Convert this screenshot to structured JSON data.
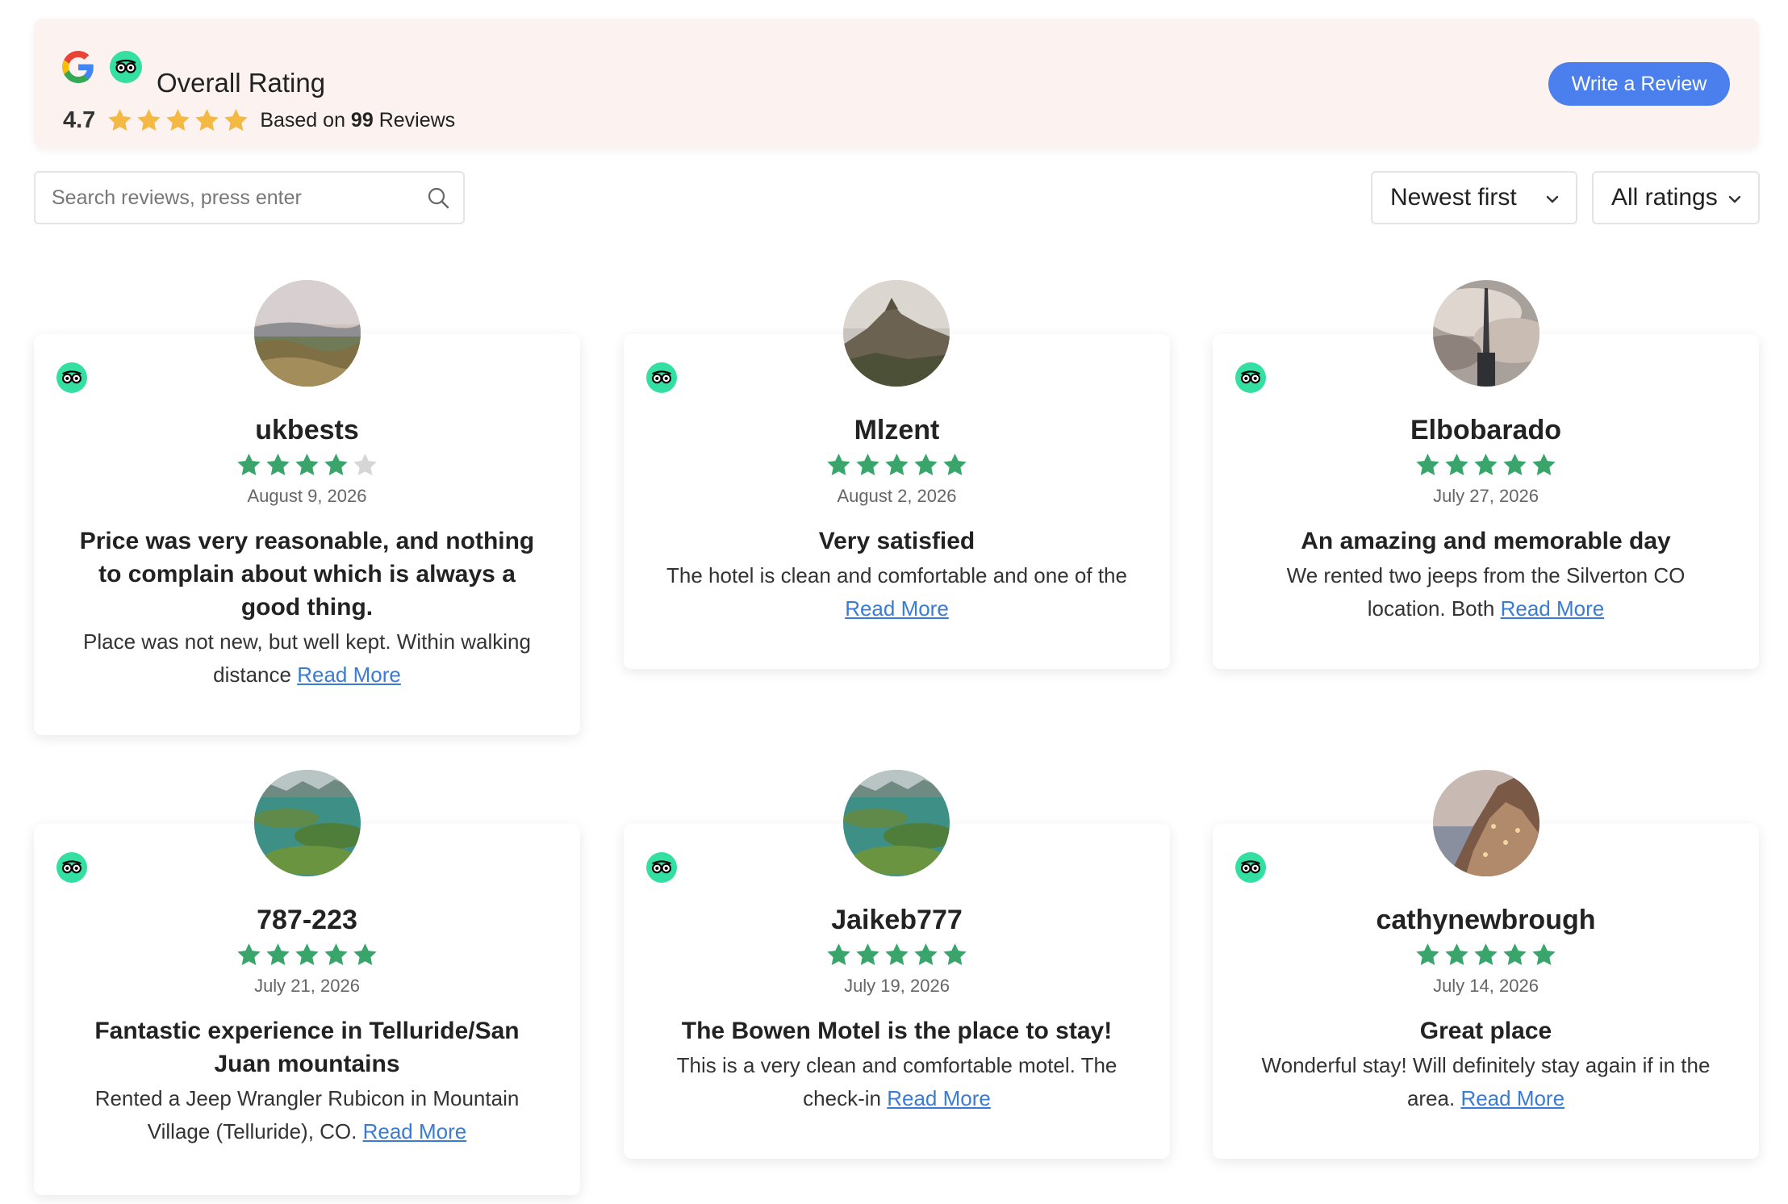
{
  "header": {
    "title": "Overall Rating",
    "rating": "4.7",
    "rating_value": 4.7,
    "based_on_prefix": "Based on",
    "review_count": "99",
    "based_on_suffix": "Reviews",
    "write_review_label": "Write a Review",
    "icons": [
      "google-icon",
      "tripadvisor-icon"
    ]
  },
  "search": {
    "placeholder": "Search reviews, press enter",
    "value": ""
  },
  "sort": {
    "selected": "Newest first"
  },
  "filter": {
    "selected": "All ratings"
  },
  "colors": {
    "header_bg": "#fcf2ef",
    "accent_button": "#4c7fee",
    "header_star": "#f4b942",
    "review_star": "#3aa56b",
    "empty_star": "#d6d6d6",
    "tripadvisor_green": "#34e0a1",
    "link": "#3a7bd5"
  },
  "reviews": [
    {
      "name": "ukbests",
      "rating": 4,
      "date": "August 9, 2026",
      "title": "Price was very reasonable, and nothing to complain about which is always a good thing.",
      "text": "Place was not new, but well kept. Within walking distance",
      "read_more": "Read More",
      "source": "tripadvisor-icon"
    },
    {
      "name": "Mlzent",
      "rating": 5,
      "date": "August 2, 2026",
      "title": "Very satisfied",
      "text": "The hotel is clean and comfortable and one of the",
      "read_more": "Read More",
      "source": "tripadvisor-icon"
    },
    {
      "name": "Elbobarado",
      "rating": 5,
      "date": "July 27, 2026",
      "title": "An amazing and memorable day",
      "text": "We rented two jeeps from the Silverton CO location. Both",
      "read_more": "Read More",
      "source": "tripadvisor-icon"
    },
    {
      "name": "787-223",
      "rating": 5,
      "date": "July 21, 2026",
      "title": "Fantastic experience in Telluride/San Juan mountains",
      "text": "Rented a Jeep Wrangler Rubicon in Mountain Village (Telluride), CO.",
      "read_more": "Read More",
      "source": "tripadvisor-icon"
    },
    {
      "name": "Jaikeb777",
      "rating": 5,
      "date": "July 19, 2026",
      "title": "The Bowen Motel is the place to stay!",
      "text": "This is a very clean and comfortable motel. The check-in",
      "read_more": "Read More",
      "source": "tripadvisor-icon"
    },
    {
      "name": "cathynewbrough",
      "rating": 5,
      "date": "July 14, 2026",
      "title": "Great place",
      "text": "Wonderful stay! Will definitely stay again if in the area.",
      "read_more": "Read More",
      "source": "tripadvisor-icon"
    }
  ]
}
